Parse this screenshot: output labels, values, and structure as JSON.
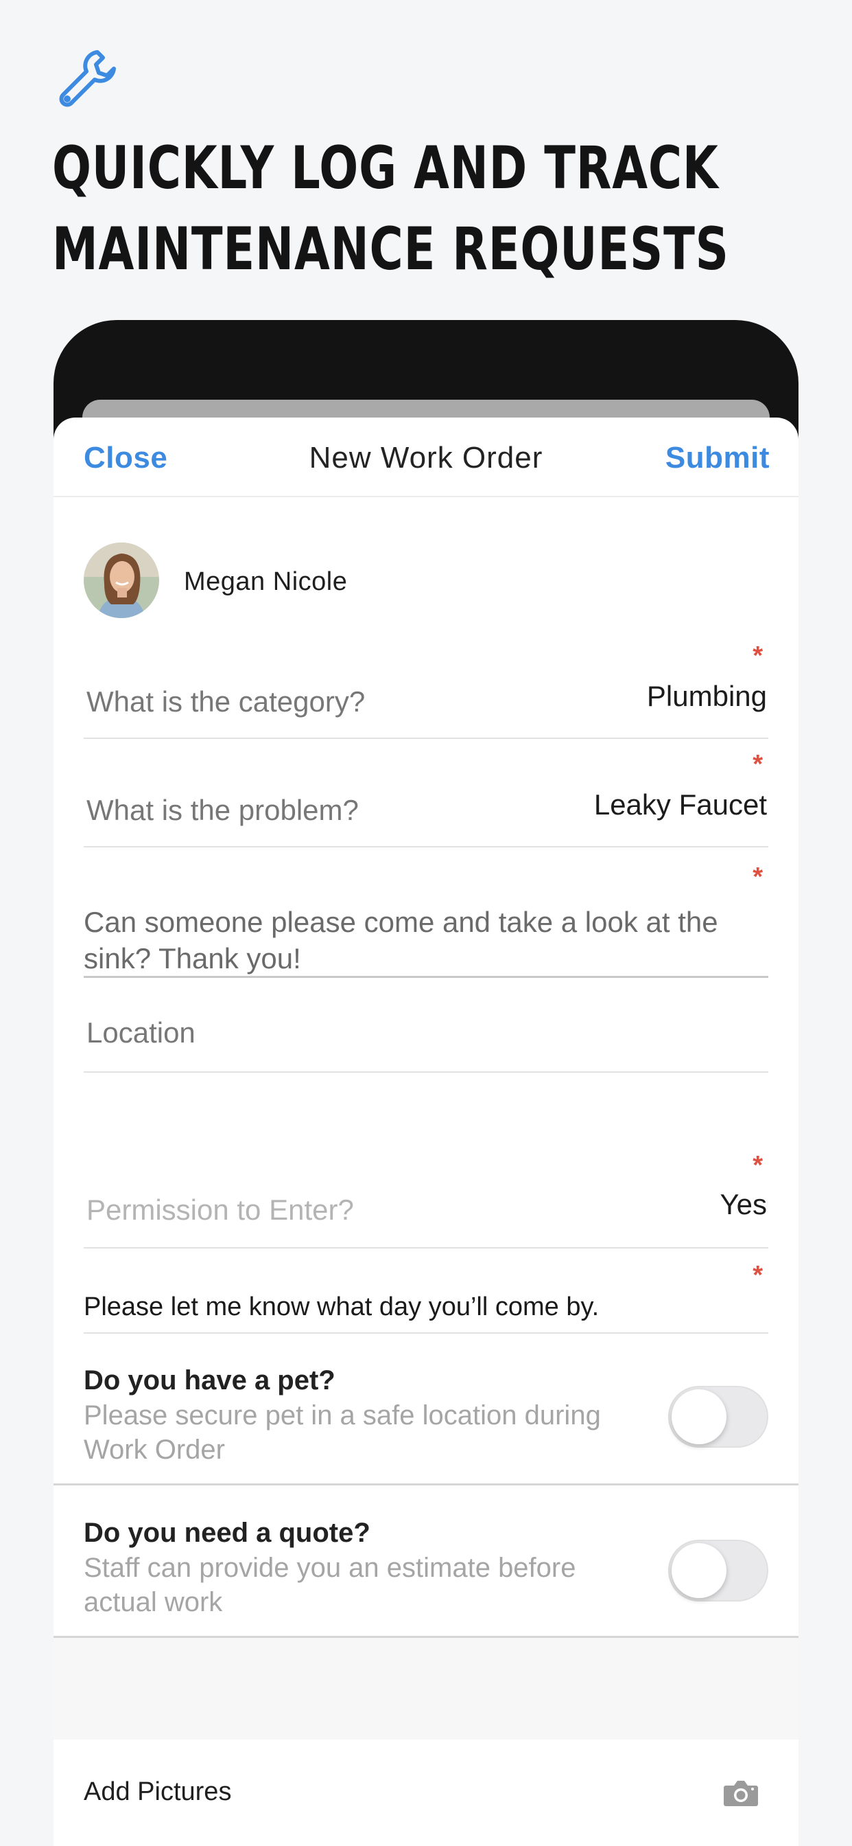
{
  "hero": {
    "icon": "wrench-icon",
    "headline_line1": "QUICKLY LOG AND TRACK",
    "headline_line2": "MAINTENANCE REQUESTS"
  },
  "navbar": {
    "close_label": "Close",
    "title": "New Work Order",
    "submit_label": "Submit"
  },
  "user": {
    "name": "Megan Nicole"
  },
  "form": {
    "required_mark": "*",
    "category": {
      "label": "What is the category?",
      "value": "Plumbing"
    },
    "problem": {
      "label": "What is the problem?",
      "value": "Leaky Faucet"
    },
    "description": {
      "value": "Can someone please come and take a look at the sink? Thank you!"
    },
    "location": {
      "placeholder": "Location"
    },
    "permission": {
      "label": "Permission to Enter?",
      "value": "Yes"
    },
    "notes": {
      "value": "Please let me know what day you’ll come by."
    },
    "pet": {
      "title": "Do you have a pet?",
      "subtitle": "Please secure pet in a safe location during Work Order",
      "enabled": false
    },
    "quote": {
      "title": "Do you need a quote?",
      "subtitle": "Staff can provide you an estimate before actual work",
      "enabled": false
    },
    "add_pictures": {
      "label": "Add Pictures",
      "icon": "camera-icon"
    }
  },
  "colors": {
    "accent": "#3d8be0",
    "required": "#e05040",
    "background": "#f5f6f8"
  }
}
